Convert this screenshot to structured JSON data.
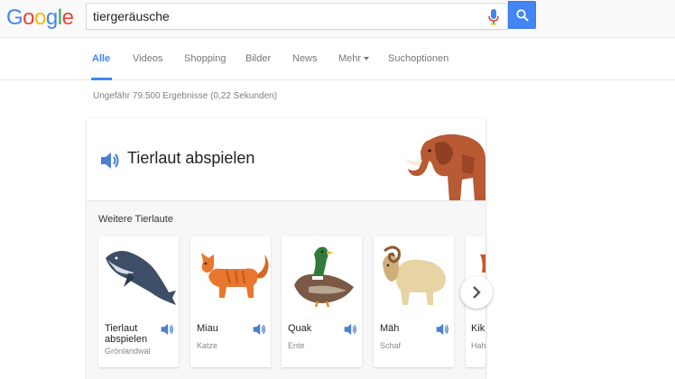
{
  "search": {
    "query": "tiergeräusche"
  },
  "logo": {
    "letters": [
      "G",
      "o",
      "o",
      "g",
      "l",
      "e"
    ],
    "colors": [
      "#4285f4",
      "#ea4335",
      "#fbbc05",
      "#4285f4",
      "#34a853",
      "#ea4335"
    ]
  },
  "tabs": [
    {
      "label": "Alle",
      "active": true
    },
    {
      "label": "Videos",
      "active": false
    },
    {
      "label": "Shopping",
      "active": false
    },
    {
      "label": "Bilder",
      "active": false
    },
    {
      "label": "News",
      "active": false
    },
    {
      "label": "Mehr",
      "active": false
    },
    {
      "label": "Suchoptionen",
      "active": false
    }
  ],
  "result_stats": "Ungefähr 79.500 Ergebnisse (0,22 Sekunden)",
  "card": {
    "title": "Tierlaut abspielen",
    "more_label": "Weitere Tierlaute",
    "animals": [
      {
        "name": "Tierlaut abspielen",
        "sub": "Grönlandwal"
      },
      {
        "name": "Miau",
        "sub": "Katze"
      },
      {
        "name": "Quak",
        "sub": "Ente"
      },
      {
        "name": "Mäh",
        "sub": "Schaf"
      },
      {
        "name": "Kik",
        "sub": "Hah"
      }
    ]
  },
  "colors": {
    "accent": "#4285f4",
    "speaker": "#4a7fd6"
  },
  "icons": [
    "google-logo",
    "microphone-icon",
    "search-icon",
    "speaker-icon",
    "chevron-right-icon"
  ]
}
